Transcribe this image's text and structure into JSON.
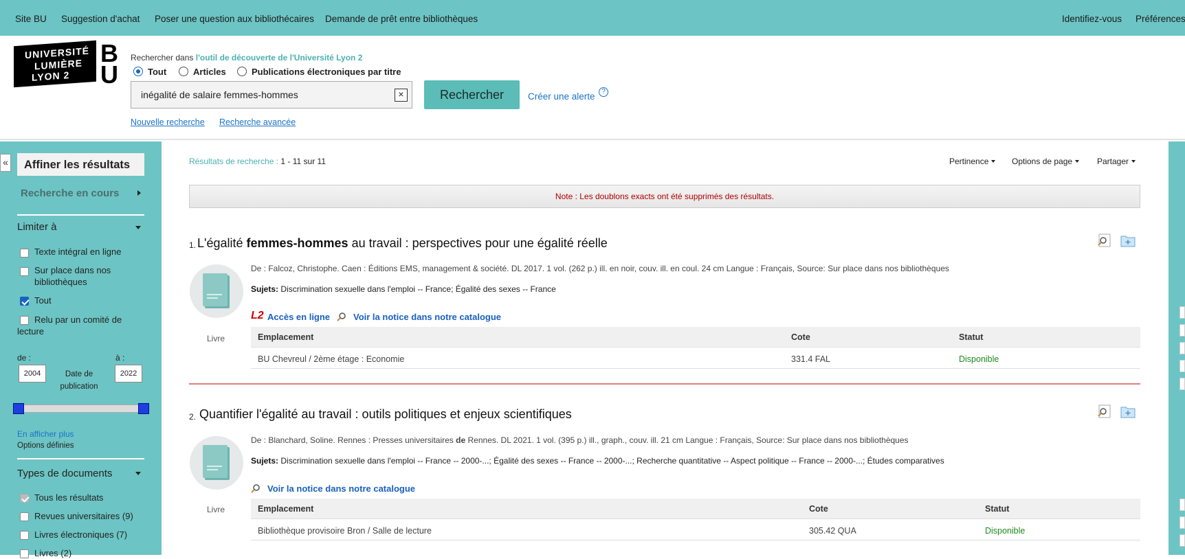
{
  "topnav": {
    "left": [
      "Site BU",
      "Suggestion d'achat",
      "Poser une question aux bibliothécaires",
      "Demande de prêt entre bibliothèques"
    ],
    "right": [
      "Identifiez-vous",
      "Préférences"
    ]
  },
  "logo": {
    "line1": "UNIVERSITÉ",
    "line2": "LUMIÈRE",
    "line3": "LYON 2",
    "bu": "BU"
  },
  "search": {
    "label_prefix": "Rechercher dans",
    "label_link": "l'outil de découverte de l'Université Lyon 2",
    "scopes": [
      "Tout",
      "Articles",
      "Publications électroniques par titre"
    ],
    "selected_scope": "Tout",
    "query": "inégalité de salaire femmes-hommes",
    "clear_symbol": "×",
    "button": "Rechercher",
    "alert_link": "Créer une alerte",
    "help_symbol": "?",
    "new_search": "Nouvelle recherche",
    "advanced_search": "Recherche avancée"
  },
  "sidebar": {
    "collapse_symbol": "«",
    "title": "Affiner les résultats",
    "current_search": "Recherche en cours",
    "limit_title": "Limiter à",
    "limits": [
      {
        "label": "Texte intégral en ligne",
        "checked": false
      },
      {
        "label": "Sur place dans nos bibliothèques",
        "checked": false
      },
      {
        "label": "Tout",
        "checked": true
      },
      {
        "label": "Relu par un comité de lecture",
        "checked": false
      }
    ],
    "from_label": "de :",
    "to_label": "à :",
    "from_year": "2004",
    "to_year": "2022",
    "date_label": "Date de publication",
    "show_more": "En afficher plus",
    "options_defined": "Options définies",
    "doc_types_title": "Types de documents",
    "doc_types": [
      {
        "label": "Tous les résultats",
        "checked": true
      },
      {
        "label": "Revues universitaires (9)",
        "checked": false
      },
      {
        "label": "Livres électroniques (7)",
        "checked": false
      },
      {
        "label": "Livres (2)",
        "checked": false
      }
    ]
  },
  "results": {
    "count_label": "Résultats de recherche :",
    "count_value": "1 - 11 sur 11",
    "sort": [
      "Pertinence",
      "Options de page",
      "Partager"
    ],
    "note": "Note : Les doublons exacts ont été supprimés des résultats.",
    "holdings_headers": [
      "Emplacement",
      "Cote",
      "Statut"
    ],
    "items": [
      {
        "number": "1.",
        "title_pre": "L'égalité ",
        "title_bold": "femmes-hommes",
        "title_post": " au travail : perspectives pour une égalité réelle",
        "doc_type": "Livre",
        "meta": "De : Falcoz, Christophe. Caen : Éditions EMS, management & société. DL 2017. 1 vol. (262 p.) ill. en noir, couv. ill. en coul. 24 cm Langue : Français, Source: Sur place dans nos bibliothèques",
        "subjects_label": "Sujets:",
        "subjects": "Discrimination sexuelle dans l'emploi -- France; Égalité des sexes -- France",
        "online_access": "Accès en ligne",
        "catalog_link": "Voir la notice dans notre catalogue",
        "holding": {
          "location": "BU Chevreul / 2ème étage : Economie",
          "call_number": "331.4 FAL",
          "status": "Disponible"
        }
      },
      {
        "number": "2.",
        "title_pre": "Quantifier l'égalité au travail : outils politiques et enjeux scientifiques",
        "title_bold": "",
        "title_post": "",
        "doc_type": "Livre",
        "meta_pre": "De : Blanchard, Soline. Rennes : Presses universitaires ",
        "meta_bold": "de",
        "meta_post": " Rennes. DL 2021. 1 vol. (395 p.) ill., graph., couv. ill. 21 cm Langue : Français, Source: Sur place dans nos bibliothèques",
        "subjects_label": "Sujets:",
        "subjects": "Discrimination sexuelle dans l'emploi -- France -- 2000-...; Égalité des sexes -- France -- 2000-...; Recherche quantitative -- Aspect politique -- France -- 2000-...; Études comparatives",
        "catalog_link": "Voir la notice dans notre catalogue",
        "holding": {
          "location": "Bibliothèque provisoire Bron / Salle de lecture",
          "call_number": "305.42 QUA",
          "status": "Disponible"
        }
      }
    ]
  },
  "colors": {
    "teal": "#6dc4c4",
    "button": "#5bbcb8",
    "link": "#1a73c8",
    "available": "#1f8a1f",
    "note": "#b00000"
  }
}
